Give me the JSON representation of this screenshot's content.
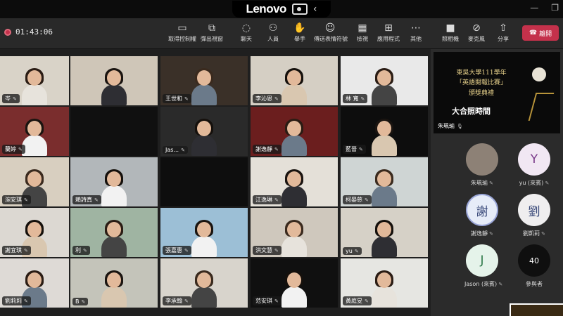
{
  "device": {
    "brand": "Lenovo"
  },
  "toolbar": {
    "timer": "01:43:06",
    "buttons": [
      {
        "label": "取得控制權",
        "icon": "screen-share-icon"
      },
      {
        "label": "彈出視窗",
        "icon": "popout-icon"
      },
      {
        "label": "聊天",
        "icon": "chat-icon"
      },
      {
        "label": "人員",
        "icon": "people-icon"
      },
      {
        "label": "舉手",
        "icon": "raise-hand-icon"
      },
      {
        "label": "傳送表情符號",
        "icon": "emoji-icon"
      },
      {
        "label": "檢視",
        "icon": "grid-view-icon"
      },
      {
        "label": "應用程式",
        "icon": "apps-icon"
      },
      {
        "label": "其他",
        "icon": "more-icon"
      },
      {
        "label": "照相機",
        "icon": "camera-icon"
      },
      {
        "label": "麥克風",
        "icon": "mic-off-icon"
      },
      {
        "label": "分享",
        "icon": "share-icon"
      }
    ],
    "leave_label": "離開",
    "leave_color": "#c4314b"
  },
  "grid": {
    "tiles": [
      {
        "name": "岑",
        "bg": "#d9d3c8"
      },
      {
        "name": "",
        "bg": "#cfc6b8"
      },
      {
        "name": "王世和",
        "bg": "#3a3028"
      },
      {
        "name": "李沁恩",
        "bg": "#d5cfc4"
      },
      {
        "name": "林 寬",
        "bg": "#e9e9e9"
      },
      {
        "name": "蘭婷",
        "bg": "#7a2d2d"
      },
      {
        "name": "",
        "bg": "#101010"
      },
      {
        "name": "Jas...",
        "bg": "#2a2a2a"
      },
      {
        "name": "謝逸靜",
        "bg": "#6b1e1e"
      },
      {
        "name": "藍晉",
        "bg": "#0d0d0d"
      },
      {
        "name": "涴安琪",
        "bg": "#d8cfc0"
      },
      {
        "name": "賴詩真",
        "bg": "#b2b7ba"
      },
      {
        "name": "",
        "bg": "#0e0e0e"
      },
      {
        "name": "江逸琳",
        "bg": "#e4e0d8"
      },
      {
        "name": "柯晏慈",
        "bg": "#cfd5d4"
      },
      {
        "name": "謝宜琪",
        "bg": "#dcd8d2"
      },
      {
        "name": "利",
        "bg": "#9fb4a2"
      },
      {
        "name": "張嘉惠",
        "bg": "#9cbfd6"
      },
      {
        "name": "洪文慧",
        "bg": "#cfc8bd"
      },
      {
        "name": "yu",
        "bg": "#d6d1c7"
      },
      {
        "name": "劉莉莉",
        "bg": "#dedad6"
      },
      {
        "name": "B",
        "bg": "#c4c4ba"
      },
      {
        "name": "李承翰",
        "bg": "#d8d4cc"
      },
      {
        "name": "范安琪",
        "bg": "#101010"
      },
      {
        "name": "黃庭旻",
        "bg": "#e6e6e2"
      },
      {
        "name": "曾郁萱",
        "bg": "#d7d2ca"
      }
    ]
  },
  "sidebar": {
    "banner": {
      "line1": "東吳大學111學年",
      "line2": "「英語閱報比賽」",
      "line3": "頒獎典禮",
      "line4": "大合照時間",
      "presenter": "朱珮瑜"
    },
    "participants": [
      {
        "name": "朱珮瑜",
        "initial": "",
        "bg": "#8d8176"
      },
      {
        "name": "yu (來賓)",
        "initial": "Y",
        "bg": "#f1e7f3"
      },
      {
        "name": "謝逸靜",
        "initial": "謝",
        "bg": "#e6ecf8"
      },
      {
        "name": "劉凱莉",
        "initial": "劉",
        "bg": "#efeeef"
      },
      {
        "name": "Jason (來賓)",
        "initial": "J",
        "bg": "#e5f3ea"
      },
      {
        "name": "參與者",
        "initial": "40",
        "bg": "#0f0f0f"
      }
    ]
  }
}
